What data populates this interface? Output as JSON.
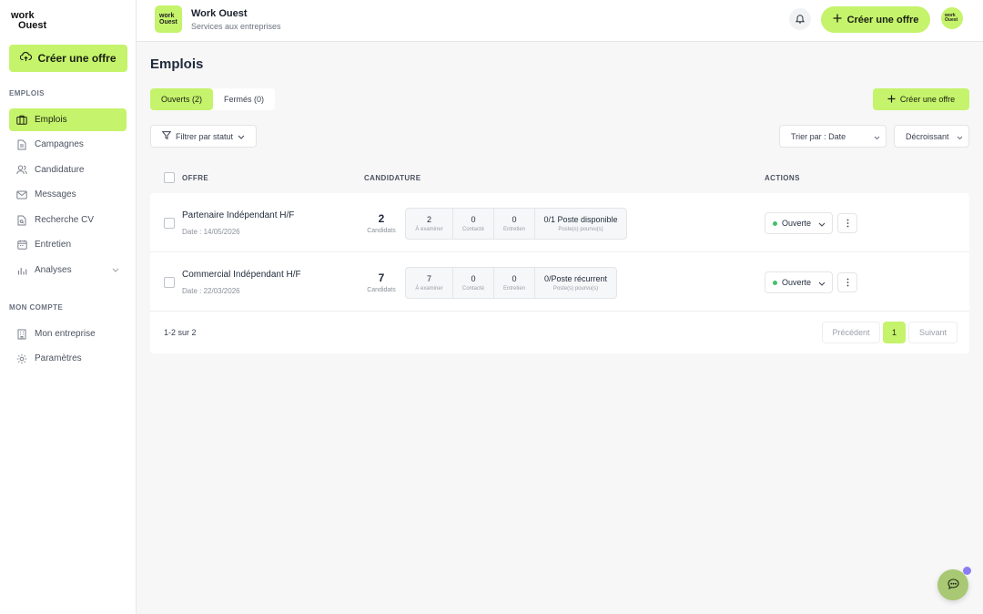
{
  "brand": {
    "logo_line1": "work",
    "logo_line2": "Ouest"
  },
  "sidebar": {
    "create_label": "Créer une offre",
    "section_jobs": "EMPLOIS",
    "section_account": "MON COMPTE",
    "items": [
      {
        "label": "Emplois",
        "icon": "briefcase-icon"
      },
      {
        "label": "Campagnes",
        "icon": "document-icon"
      },
      {
        "label": "Candidature",
        "icon": "users-icon"
      },
      {
        "label": "Messages",
        "icon": "mail-icon"
      },
      {
        "label": "Recherche CV",
        "icon": "file-search-icon"
      },
      {
        "label": "Entretien",
        "icon": "calendar-icon"
      },
      {
        "label": "Analyses",
        "icon": "chart-icon"
      }
    ],
    "account_items": [
      {
        "label": "Mon entreprise",
        "icon": "building-icon"
      },
      {
        "label": "Paramètres",
        "icon": "gear-icon"
      }
    ]
  },
  "header": {
    "company_logo_line1": "work",
    "company_logo_line2": "Ouest",
    "company_name": "Work Ouest",
    "company_subtitle": "Services aux entreprises",
    "create_label": "Créer une offre",
    "avatar_line1": "work",
    "avatar_line2": "Ouest"
  },
  "main": {
    "title": "Emplois",
    "tabs": [
      {
        "label": "Ouverts (2)",
        "active": true
      },
      {
        "label": "Fermés (0)",
        "active": false
      }
    ],
    "create_label": "Créer une offre",
    "filter_label": "Filtrer par statut",
    "sort_label": "Trier par : Date",
    "order_label": "Décroissant",
    "columns": {
      "offer": "OFFRE",
      "applications": "CANDIDATURE",
      "actions": "ACTIONS"
    },
    "rows": [
      {
        "title": "Partenaire Indépendant H/F",
        "date": "Date : 14/05/2026",
        "candidates": "2",
        "candidates_label": "Candidats",
        "stages": [
          {
            "value": "2",
            "label": "À examiner"
          },
          {
            "value": "0",
            "label": "Contacté"
          },
          {
            "value": "0",
            "label": "Entretien"
          }
        ],
        "post_value": "0/1 Poste disponible",
        "post_label": "Poste(s) pourvu(s)",
        "status": "Ouverte"
      },
      {
        "title": "Commercial Indépendant H/F",
        "date": "Date : 22/03/2026",
        "candidates": "7",
        "candidates_label": "Candidats",
        "stages": [
          {
            "value": "7",
            "label": "À examiner"
          },
          {
            "value": "0",
            "label": "Contacté"
          },
          {
            "value": "0",
            "label": "Entretien"
          }
        ],
        "post_value": "0/Poste récurrent",
        "post_label": "Poste(s) pourvu(s)",
        "status": "Ouverte"
      }
    ],
    "pagination": {
      "info": "1-2 sur 2",
      "prev": "Précédent",
      "page": "1",
      "next": "Suivant"
    }
  },
  "colors": {
    "accent": "#c5f36b",
    "status_open": "#45c06a",
    "chat_badge": "#8b7cf2"
  }
}
